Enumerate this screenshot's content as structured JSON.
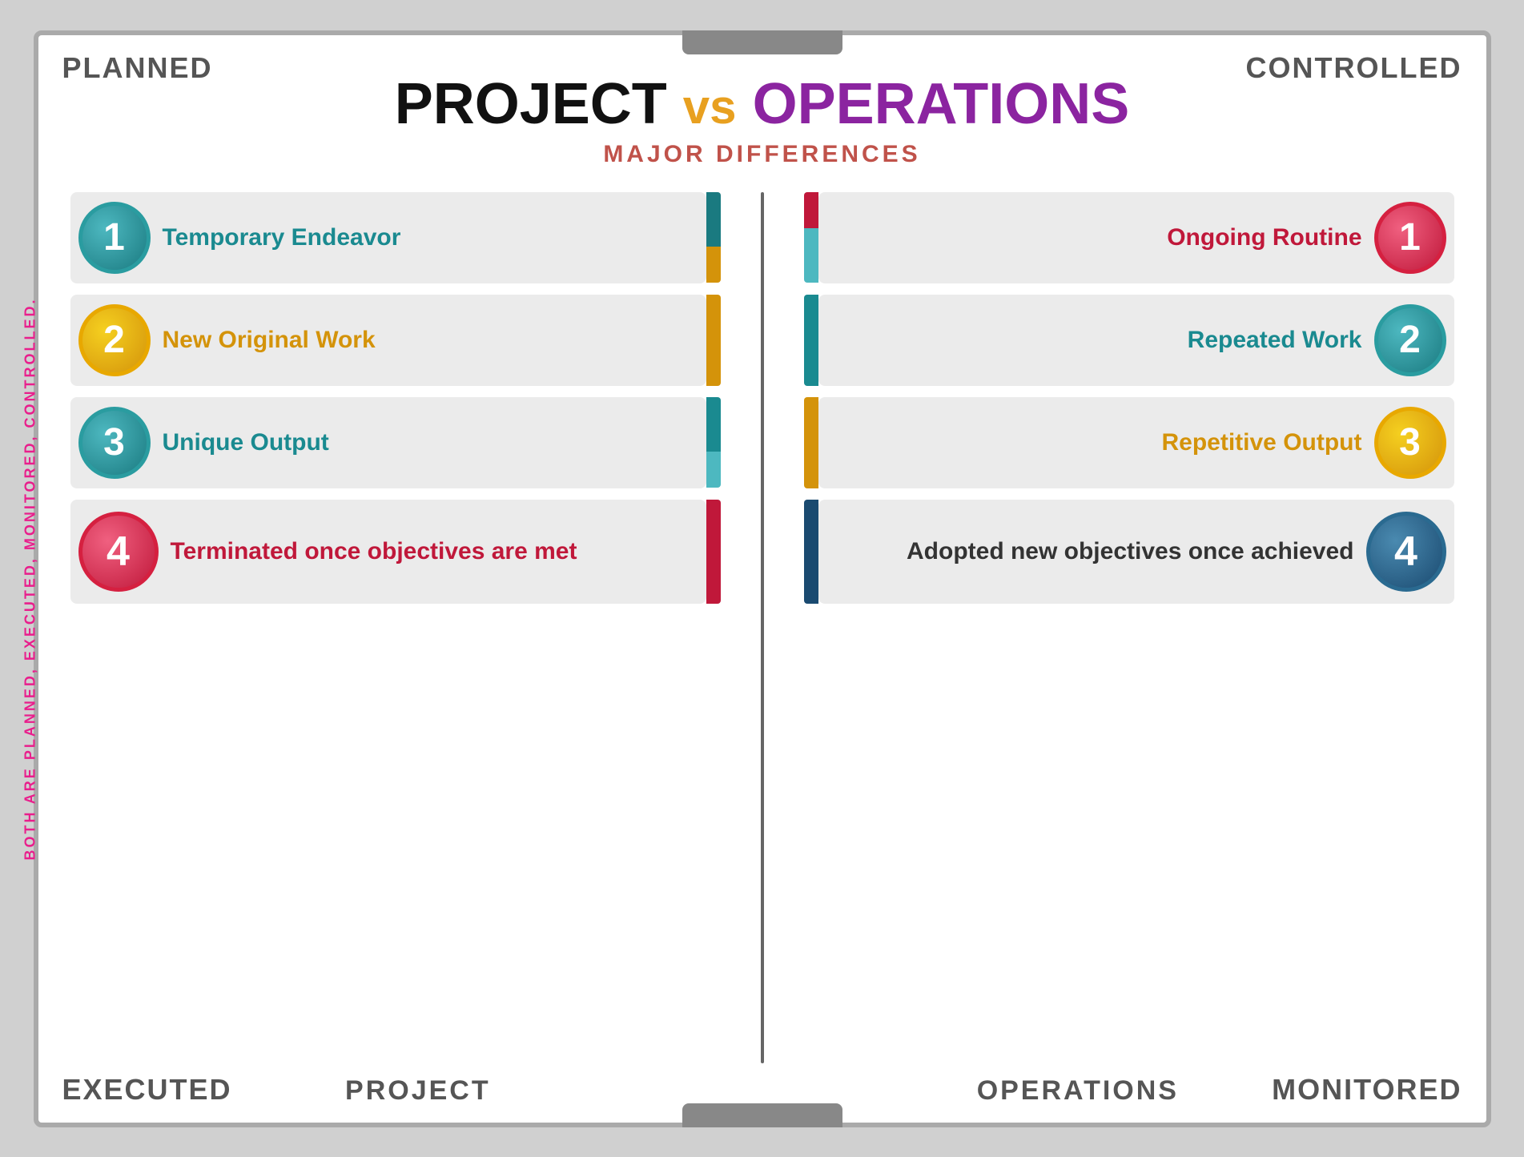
{
  "corners": {
    "top_left": "PLANNED",
    "top_right": "CONTROLLED",
    "bottom_left": "EXECUTED",
    "bottom_right": "MONITORED"
  },
  "side_text": "BOTH ARE PLANNED, EXECUTED, MONITORED, CONTROLLED.",
  "title": {
    "project": "PROJECT",
    "vs": "vs",
    "operations": "OPERATIONS",
    "subtitle": "MAJOR DIFFERENCES"
  },
  "project_items": [
    {
      "num": "1",
      "text": "Temporary Endeavor",
      "text_class": "text-teal",
      "circle_class": "circle-teal",
      "bar_color": "#1a7a80",
      "bar_color2": "#d4930a"
    },
    {
      "num": "2",
      "text": "New Original Work",
      "text_class": "text-gold",
      "circle_class": "circle-gold",
      "bar_color": "#d4930a",
      "bar_color2": "#f5d020"
    },
    {
      "num": "3",
      "text": "Unique Output",
      "text_class": "text-teal2",
      "circle_class": "circle-teal2",
      "bar_color": "#1a8a90",
      "bar_color2": "#4db8c0"
    },
    {
      "num": "4",
      "text": "Terminated once objectives are met",
      "text_class": "text-red",
      "circle_class": "circle-red",
      "bar_color": "#c0183a",
      "bar_color2": "#f06080"
    }
  ],
  "ops_items": [
    {
      "num": "1",
      "text": "Ongoing Routine",
      "text_class": "text-red2",
      "circle_class": "circle-red2",
      "bar_color": "#c0183a",
      "bar_color2": "#f06080"
    },
    {
      "num": "2",
      "text": "Repeated Work",
      "text_class": "text-teal3",
      "circle_class": "circle-teal3",
      "bar_color": "#1a8a90",
      "bar_color2": "#4db8c0"
    },
    {
      "num": "3",
      "text": "Repetitive Output",
      "text_class": "text-gold2",
      "circle_class": "circle-gold2",
      "bar_color": "#d4930a",
      "bar_color2": "#f5d020"
    },
    {
      "num": "4",
      "text": "Adopted new objectives once achieved",
      "text_class": "text-dark",
      "circle_class": "circle-darkblue",
      "bar_color": "#1a4a70",
      "bar_color2": "#4a8ab0"
    }
  ],
  "bottom_labels": {
    "project": "PROJECT",
    "operations": "OPERATIONS"
  }
}
